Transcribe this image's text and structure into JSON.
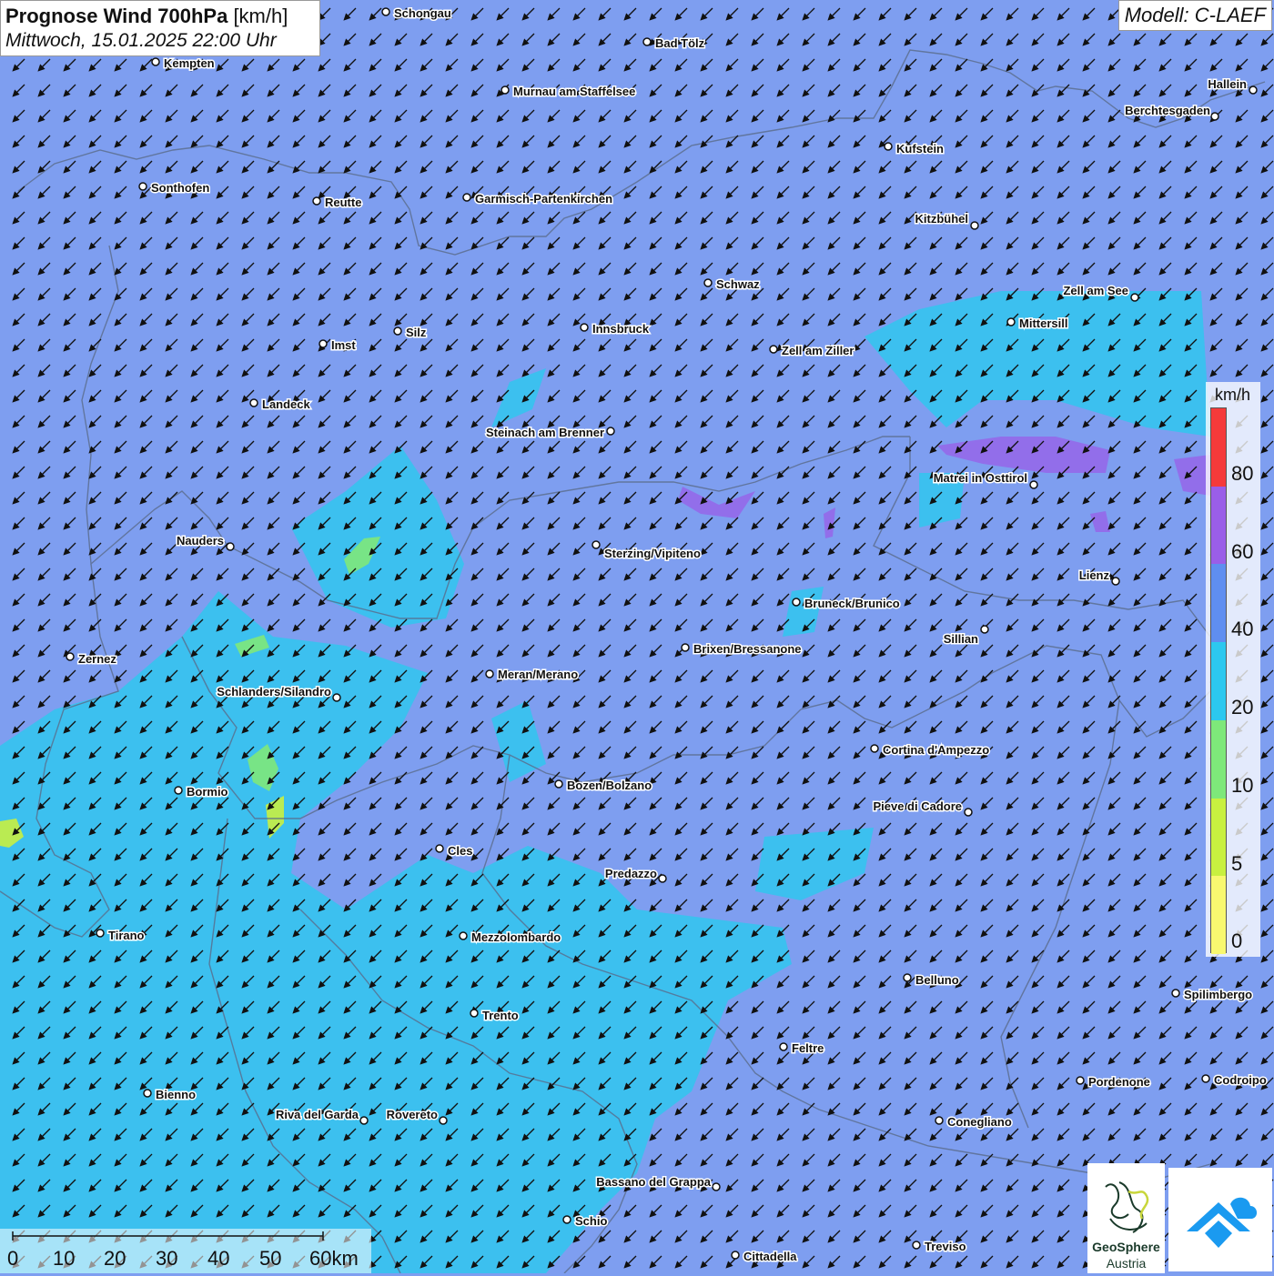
{
  "header": {
    "title_bold": "Prognose Wind 700hPa",
    "title_unit": "[km/h]",
    "datetime": "Mittwoch, 15.01.2025 22:00 Uhr",
    "model": "Modell: C-LAEF"
  },
  "legend": {
    "unit": "km/h",
    "labels": [
      "80",
      "60",
      "40",
      "20",
      "10",
      "5",
      "0"
    ],
    "colors": [
      "#f53a3a",
      "#9a5ee8",
      "#5f8ef0",
      "#2cc8ef",
      "#7ee87a",
      "#c8f040",
      "#f8f870"
    ]
  },
  "scalebar": {
    "ticks": [
      "0",
      "10",
      "20",
      "30",
      "40",
      "50",
      "60km"
    ]
  },
  "logos": {
    "geosphere_name": "GeoSphere",
    "geosphere_sub": "Austria"
  },
  "map": {
    "base_color": "#7e9ef0",
    "wind_arrow": "arrow-southwest-icon",
    "places": [
      {
        "name": "Schongau"
      },
      {
        "name": "Bad Tölz"
      },
      {
        "name": "Kempten"
      },
      {
        "name": "Murnau am Staffelsee"
      },
      {
        "name": "Hallein"
      },
      {
        "name": "Berchtesgaden"
      },
      {
        "name": "Kufstein"
      },
      {
        "name": "Sonthofen"
      },
      {
        "name": "Reutte"
      },
      {
        "name": "Garmisch-Partenkirchen"
      },
      {
        "name": "Kitzbühel"
      },
      {
        "name": "Schwaz"
      },
      {
        "name": "Zell am See"
      },
      {
        "name": "Mittersill"
      },
      {
        "name": "Innsbruck"
      },
      {
        "name": "Silz"
      },
      {
        "name": "Imst"
      },
      {
        "name": "Zell am Ziller"
      },
      {
        "name": "Landeck"
      },
      {
        "name": "Steinach am Brenner"
      },
      {
        "name": "Matrei in Osttirol"
      },
      {
        "name": "Nauders"
      },
      {
        "name": "Sterzing/Vipiteno"
      },
      {
        "name": "Lienz"
      },
      {
        "name": "Bruneck/Brunico"
      },
      {
        "name": "Sillian"
      },
      {
        "name": "Zernez"
      },
      {
        "name": "Brixen/Bressanone"
      },
      {
        "name": "Meran/Merano"
      },
      {
        "name": "Schlanders/Silandro"
      },
      {
        "name": "Cortina d'Ampezzo"
      },
      {
        "name": "Bormio"
      },
      {
        "name": "Bozen/Bolzano"
      },
      {
        "name": "Pieve di Cadore"
      },
      {
        "name": "Cles"
      },
      {
        "name": "Predazzo"
      },
      {
        "name": "Tirano"
      },
      {
        "name": "Mezzolombardo"
      },
      {
        "name": "Belluno"
      },
      {
        "name": "Spilimbergo"
      },
      {
        "name": "Trento"
      },
      {
        "name": "Feltre"
      },
      {
        "name": "Pordenone"
      },
      {
        "name": "Codroipo"
      },
      {
        "name": "Bienno"
      },
      {
        "name": "Riva del Garda"
      },
      {
        "name": "Rovereto"
      },
      {
        "name": "Conegliano"
      },
      {
        "name": "Bassano del Grappa"
      },
      {
        "name": "Schio"
      },
      {
        "name": "Treviso"
      },
      {
        "name": "Cittadella"
      }
    ]
  }
}
